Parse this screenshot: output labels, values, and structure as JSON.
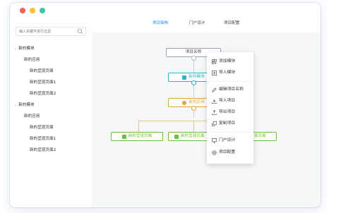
{
  "window": {
    "traffic_lights": [
      {
        "name": "close",
        "color": "#f25f58"
      },
      {
        "name": "minimize",
        "color": "#fbbe2e"
      },
      {
        "name": "zoom",
        "color": "#3ec7a3"
      }
    ]
  },
  "sidebar": {
    "search_placeholder": "输入关键字进行过滤",
    "tree": [
      {
        "label": "新的模块",
        "level": 0,
        "expanded": true
      },
      {
        "label": "新的应用",
        "level": 1
      },
      {
        "label": "新的呈现页面",
        "level": 2
      },
      {
        "label": "新的呈现页面1",
        "level": 2
      },
      {
        "label": "新的呈现页面2",
        "level": 2
      },
      {
        "label": "新的模块",
        "level": 0,
        "expanded": true
      },
      {
        "label": "新的应用",
        "level": 1
      },
      {
        "label": "新的呈现页面",
        "level": 2
      },
      {
        "label": "新的呈现页面1",
        "level": 2
      },
      {
        "label": "新的呈现页面2",
        "level": 2
      }
    ]
  },
  "tabs": [
    {
      "label": "项目架构",
      "active": true
    },
    {
      "label": "门户设计",
      "active": false
    },
    {
      "label": "项目配置",
      "active": false
    }
  ],
  "canvas": {
    "root": "项目名称",
    "module": "新的模块",
    "app": "新的应用",
    "pages": [
      "新的呈现页面",
      "新的呈现页面",
      "呈现页面"
    ],
    "colors": {
      "module": "#2bb3c0",
      "app": "#e6a23c",
      "page": "#67c23a"
    }
  },
  "context_menu": {
    "items": [
      "添加模块",
      "导入模块",
      "编辑项目名称",
      "导入项目",
      "导出项目",
      "复制项目",
      "门户设计",
      "项目配置"
    ],
    "icons": [
      "add-module-icon",
      "import-module-icon",
      "edit-icon",
      "import-icon",
      "export-icon",
      "copy-icon",
      "monitor-icon",
      "gear-icon"
    ]
  }
}
